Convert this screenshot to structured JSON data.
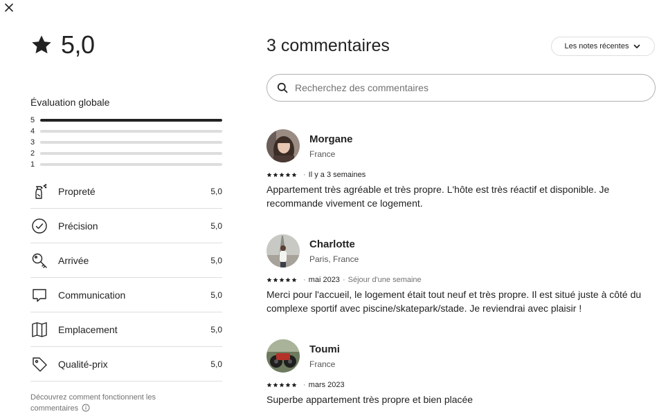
{
  "overall": {
    "rating": "5,0"
  },
  "distribution": {
    "title": "Évaluation globale",
    "rows": [
      {
        "label": "5",
        "fraction": 1.0
      },
      {
        "label": "4",
        "fraction": 0.0
      },
      {
        "label": "3",
        "fraction": 0.0
      },
      {
        "label": "2",
        "fraction": 0.0
      },
      {
        "label": "1",
        "fraction": 0.0
      }
    ]
  },
  "categories": [
    {
      "label": "Propreté",
      "score": "5,0",
      "icon": "spray-bottle-icon"
    },
    {
      "label": "Précision",
      "score": "5,0",
      "icon": "check-circle-icon"
    },
    {
      "label": "Arrivée",
      "score": "5,0",
      "icon": "key-icon"
    },
    {
      "label": "Communication",
      "score": "5,0",
      "icon": "chat-bubble-icon"
    },
    {
      "label": "Emplacement",
      "score": "5,0",
      "icon": "map-icon"
    },
    {
      "label": "Qualité-prix",
      "score": "5,0",
      "icon": "price-tag-icon"
    }
  ],
  "how_it_works": {
    "text": "Découvrez comment fonctionnent les commentaires"
  },
  "reviews_header": {
    "count_title": "3 commentaires",
    "sort_label": "Les notes récentes",
    "search_placeholder": "Recherchez des commentaires"
  },
  "reviews": [
    {
      "name": "Morgane",
      "location": "France",
      "stars": 5,
      "date": "Il y a 3 semaines",
      "stay": "",
      "text": "Appartement très agréable et très propre. L'hôte est très réactif et disponible. Je recommande vivement ce logement."
    },
    {
      "name": "Charlotte",
      "location": "Paris, France",
      "stars": 5,
      "date": "mai 2023",
      "stay": "Séjour d'une semaine",
      "text": "Merci pour l'accueil, le logement était tout neuf et très propre. Il est situé juste à côté du complexe sportif avec piscine/skatepark/stade. Je reviendrai avec plaisir !"
    },
    {
      "name": "Toumi",
      "location": "France",
      "stars": 5,
      "date": "mars 2023",
      "stay": "",
      "text": "Superbe appartement très propre et bien placée"
    }
  ],
  "colors": {
    "text": "#222222",
    "muted": "#717171",
    "divider": "#dddddd",
    "bar_fill": "#222222",
    "bar_track": "#dddddd"
  }
}
